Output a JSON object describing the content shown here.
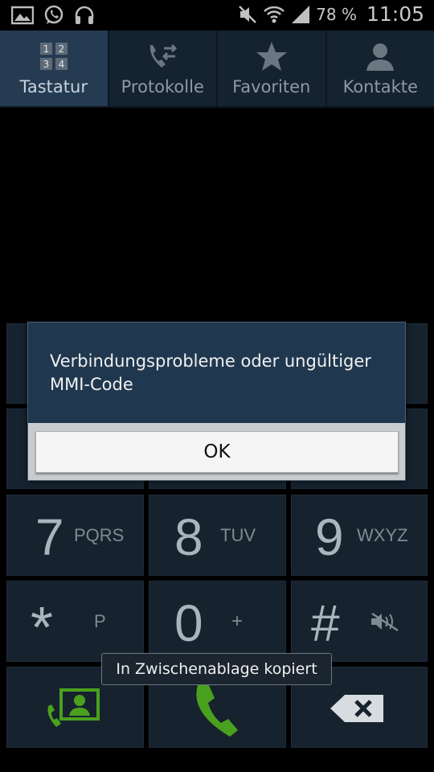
{
  "status_bar": {
    "battery_text": "78 %",
    "time": "11:05",
    "icons": [
      "gallery-icon",
      "whatsapp-icon",
      "headphones-icon",
      "mute-icon",
      "wifi-icon",
      "signal-icon"
    ]
  },
  "tabs": [
    {
      "label": "Tastatur",
      "icon": "keypad-icon",
      "active": true
    },
    {
      "label": "Protokolle",
      "icon": "call-log-icon",
      "active": false
    },
    {
      "label": "Favoriten",
      "icon": "star-icon",
      "active": false
    },
    {
      "label": "Kontakte",
      "icon": "contact-icon",
      "active": false
    }
  ],
  "keypad": {
    "row3": [
      {
        "digit": "7",
        "letters": "PQRS"
      },
      {
        "digit": "8",
        "letters": "TUV"
      },
      {
        "digit": "9",
        "letters": "WXYZ"
      }
    ],
    "row4": [
      {
        "digit": "*",
        "letters": "P"
      },
      {
        "digit": "0",
        "letters": "+"
      },
      {
        "digit": "#",
        "letters": "",
        "icon": "mute-icon"
      }
    ],
    "actions": [
      "add-contact-icon",
      "call-icon",
      "backspace-icon"
    ]
  },
  "dialog": {
    "message": "Verbindungsprobleme oder ungültiger MMI-Code",
    "ok_label": "OK"
  },
  "toast": {
    "text": "In Zwischenablage kopiert"
  },
  "colors": {
    "key_bg": "#16222e",
    "tab_active": "#243b52",
    "dialog_bg": "#20384f",
    "call_green": "#4aa11e"
  }
}
